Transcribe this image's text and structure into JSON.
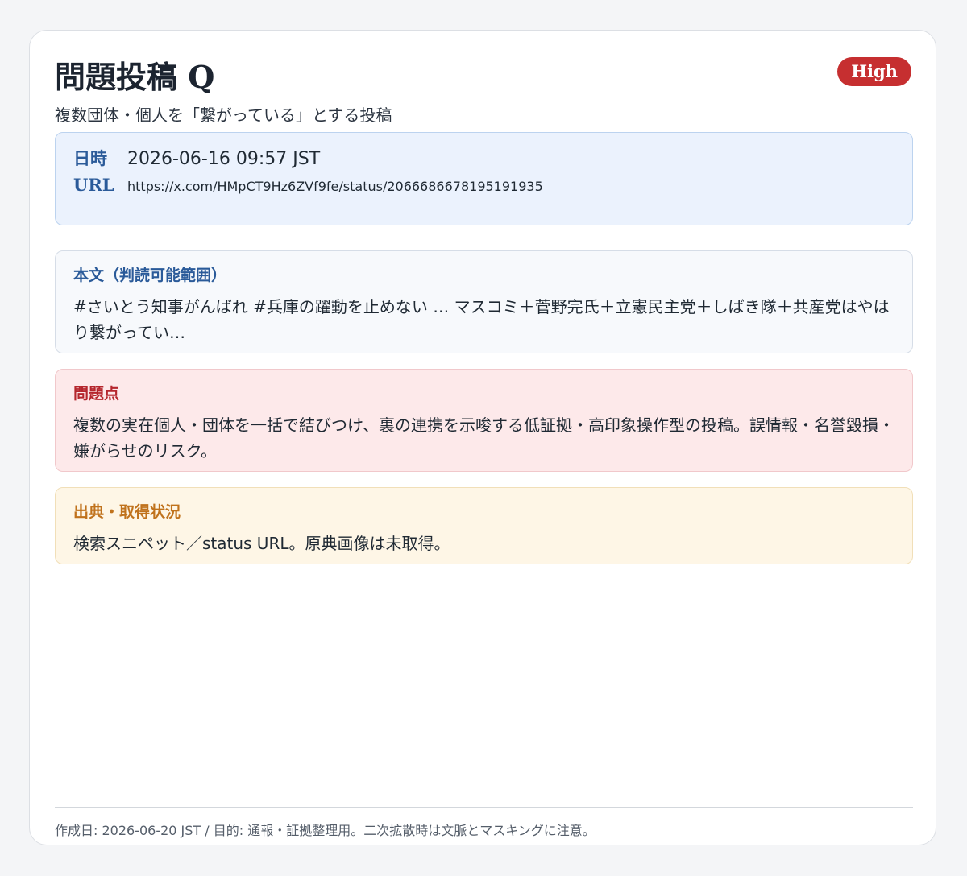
{
  "header": {
    "title": "問題投稿 Q",
    "subtitle": "複数団体・個人を「繋がっている」とする投稿",
    "severity_badge": "High"
  },
  "meta": {
    "date_label": "日時",
    "date_value": "2026-06-16 09:57 JST",
    "url_label": "URL",
    "url_value": "https://x.com/HMpCT9Hz6ZVf9fe/status/2066686678195191935"
  },
  "sections": {
    "body": {
      "label": "本文（判読可能範囲）",
      "text": "#さいとう知事がんばれ #兵庫の躍動を止めない … マスコミ＋菅野完氏＋立憲民主党＋しばき隊＋共産党はやはり繋がってい…"
    },
    "issue": {
      "label": "問題点",
      "text": "複数の実在個人・団体を一括で結びつけ、裏の連携を示唆する低証拠・高印象操作型の投稿。誤情報・名誉毀損・嫌がらせのリスク。"
    },
    "source": {
      "label": "出典・取得状況",
      "text": "検索スニペット／status URL。原典画像は未取得。"
    }
  },
  "footer": {
    "note": "作成日: 2026-06-20 JST / 目的: 通報・証拠整理用。二次拡散時は文脈とマスキングに注意。"
  },
  "colors": {
    "badge": "#c62f30",
    "meta_label": "#2a5a99",
    "issue_label": "#b5262d",
    "source_label": "#c0721c",
    "meta_background": "#ebf2fd",
    "issue_background": "#fde9ea",
    "source_background": "#fef6e6"
  }
}
